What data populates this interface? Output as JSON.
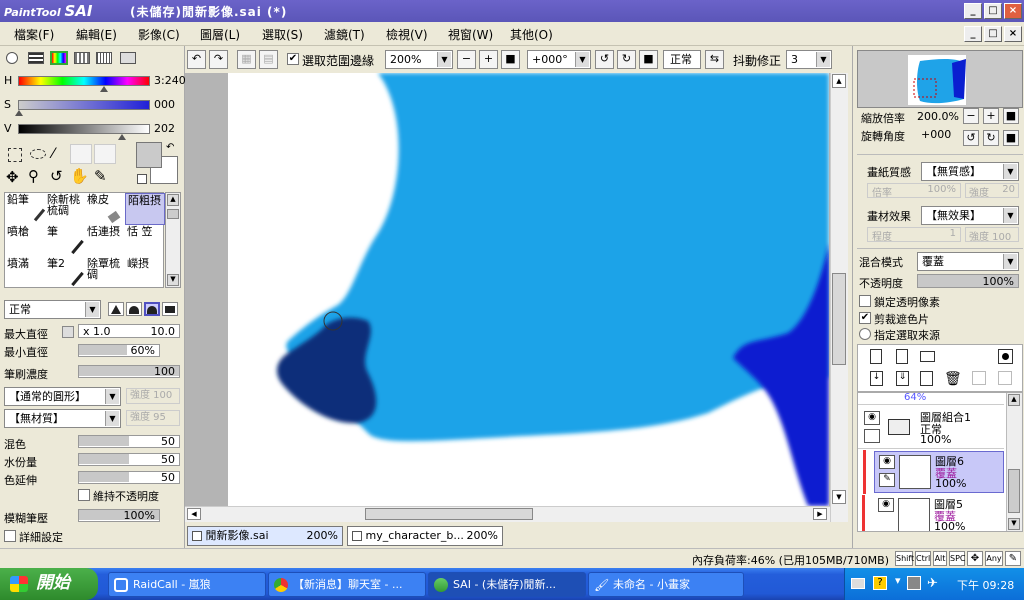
{
  "app": {
    "logo_text": "PaintTool",
    "logo_brand": "SAI",
    "window_title": "(未儲存)閒新影像.sai (*)"
  },
  "menu": [
    "檔案(F)",
    "編輯(E)",
    "影像(C)",
    "圖層(L)",
    "選取(S)",
    "濾鏡(T)",
    "檢視(V)",
    "視窗(W)",
    "其他(O)"
  ],
  "toolbar": {
    "selection_edge_label": "選取范圍邊緣",
    "selection_edge_checked": true,
    "zoom": "200%",
    "rotation": "+000°",
    "mode": "正常",
    "stabilizer_label": "抖動修正",
    "stabilizer_value": "3"
  },
  "color_panel": {
    "h_label": "H",
    "h_value": "3:240",
    "s_label": "S",
    "s_value": "000",
    "v_label": "V",
    "v_value": "202"
  },
  "tools": [
    {
      "label": "鉛筆"
    },
    {
      "label": "除斬桃梳碉"
    },
    {
      "label": "橡皮"
    },
    {
      "label": "陌粗摂"
    },
    {
      "label": "噴槍"
    },
    {
      "label": "筆"
    },
    {
      "label": "恬連摂"
    },
    {
      "label": "恬 笠"
    },
    {
      "label": "墳滿"
    },
    {
      "label": "筆2"
    },
    {
      "label": "除覃梳碉"
    },
    {
      "label": "嶸摂"
    }
  ],
  "brush": {
    "blend_mode": "正常",
    "max_size_label": "最大直徑",
    "max_size_mult": "x 1.0",
    "max_size_value": "10.0",
    "min_size_label": "最小直徑",
    "min_size_value": "60%",
    "density_label": "筆刷濃度",
    "density_value": "100",
    "shape": "【通常的圓形】",
    "shape_strength": "強度 100",
    "texture": "【無材質】",
    "texture_strength": "強度 95",
    "blend_label": "混色",
    "blend_value": "50",
    "water_label": "水份量",
    "water_value": "50",
    "stretch_label": "色延伸",
    "stretch_value": "50",
    "keep_opacity_label": "維持不透明度",
    "blur_label": "模糊筆壓",
    "blur_value": "100%",
    "detail_label": "詳細設定"
  },
  "navigator": {
    "zoom_label": "縮放倍率",
    "zoom_value": "200.0%",
    "rotate_label": "旋轉角度",
    "rotate_value": "+000"
  },
  "paper": {
    "texture_label": "畫紙質感",
    "texture_value": "【無質感】",
    "rate_label": "倍率",
    "rate_value": "100%",
    "strength_label": "強度",
    "strength_value": "20",
    "effect_label": "畫材效果",
    "effect_value": "【無效果】",
    "degree_label": "程度",
    "degree_value": "1",
    "strength2_value": "強度 100"
  },
  "layer_props": {
    "blend_label": "混合模式",
    "blend_value": "覆蓋",
    "opacity_label": "不透明度",
    "opacity_value": "100%",
    "lock_label": "鎖定透明像素",
    "clip_label": "剪裁遮色片",
    "clip_checked": true,
    "source_label": "指定選取來源"
  },
  "layers": [
    {
      "name": "64%",
      "mode": "",
      "opacity": ""
    },
    {
      "name": "圖層組合1",
      "mode": "正常",
      "opacity": "100%"
    },
    {
      "name": "圖層6",
      "mode": "覆蓋",
      "opacity": "100%"
    },
    {
      "name": "圖層5",
      "mode": "覆蓋",
      "opacity": "100%"
    }
  ],
  "doc_tabs": [
    {
      "name": "閒新影像.sai",
      "zoom": "200%"
    },
    {
      "name": "my_character_b...",
      "zoom": "200%"
    }
  ],
  "status": {
    "memory": "內存負荷率:46% (已用105MB/710MB)",
    "keys": [
      "Shift",
      "Ctrl",
      "Alt",
      "SPC",
      "Any"
    ]
  },
  "taskbar": {
    "start": "開始",
    "tasks": [
      "RaidCall - 嵐狼",
      "【新消息】聊天室 - ...",
      "SAI - (未儲存)閒新...",
      "未命名 - 小畫家"
    ],
    "clock": "下午 09:28"
  },
  "colors": {
    "title_bg": "#5b56b8",
    "light_blue": "#1fa3e8",
    "dark_navy": "#0b2f7a",
    "royal_blue": "#0a1fd0"
  }
}
